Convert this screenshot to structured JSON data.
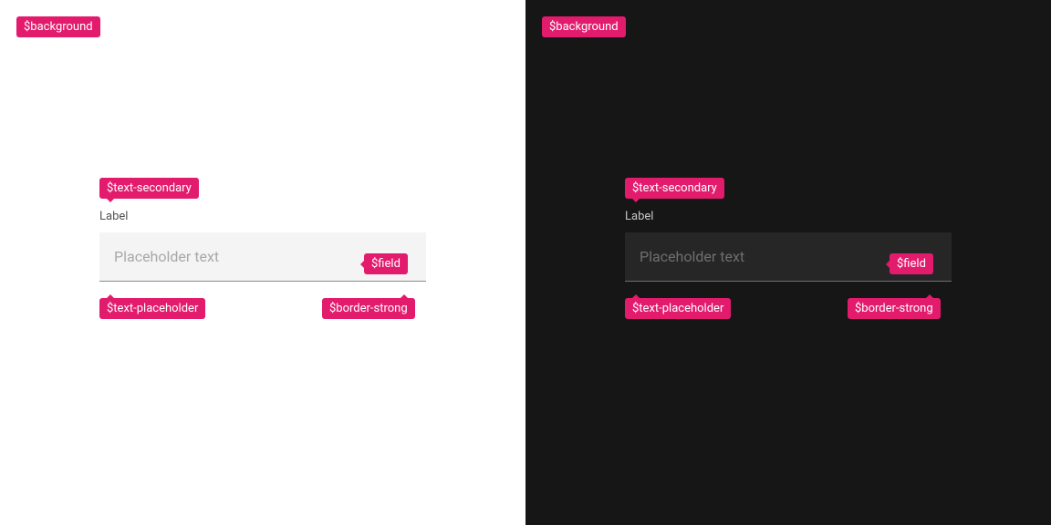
{
  "tags": {
    "background": "$background",
    "text_secondary": "$text-secondary",
    "field": "$field",
    "text_placeholder": "$text-placeholder",
    "border_strong": "$border-strong"
  },
  "field": {
    "label": "Label",
    "placeholder": "Placeholder text"
  },
  "colors": {
    "tag_bg": "#e31b6d",
    "light_bg": "#ffffff",
    "dark_bg": "#161616",
    "light_field_bg": "#f4f4f4",
    "dark_field_bg": "#262626",
    "light_label": "#525252",
    "dark_label": "#c6c6c6",
    "light_placeholder": "#a8a8a8",
    "dark_placeholder": "#6f6f6f",
    "light_border": "#8d8d8d",
    "dark_border": "#6f6f6f"
  }
}
